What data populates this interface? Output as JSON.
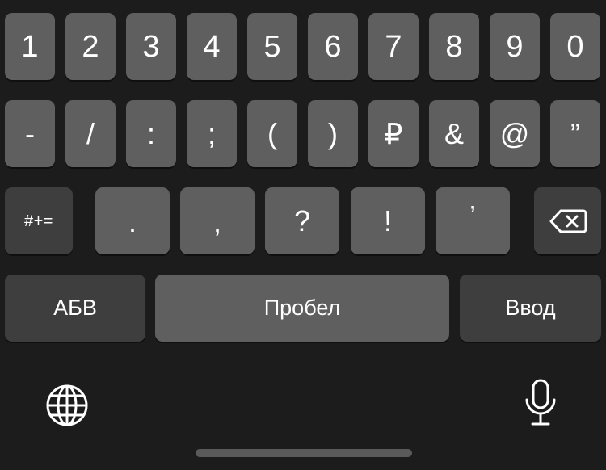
{
  "keyboard": {
    "row1": [
      "1",
      "2",
      "3",
      "4",
      "5",
      "6",
      "7",
      "8",
      "9",
      "0"
    ],
    "row2": [
      "-",
      "/",
      ":",
      ";",
      "(",
      ")",
      "₽",
      "&",
      "@",
      "”"
    ],
    "row3": {
      "shift_label": "#+=",
      "keys": [
        ".",
        ",",
        "?",
        "!",
        "’"
      ],
      "backspace_icon": "delete-left-icon"
    },
    "row4": {
      "abc_label": "АБВ",
      "space_label": "Пробел",
      "return_label": "Ввод"
    },
    "bottom": {
      "globe_icon": "globe-icon",
      "mic_icon": "microphone-icon"
    }
  },
  "colors": {
    "background": "#1c1c1c",
    "key": "#5f5f5f",
    "function_key": "#3e3e3e",
    "text": "#ffffff"
  }
}
